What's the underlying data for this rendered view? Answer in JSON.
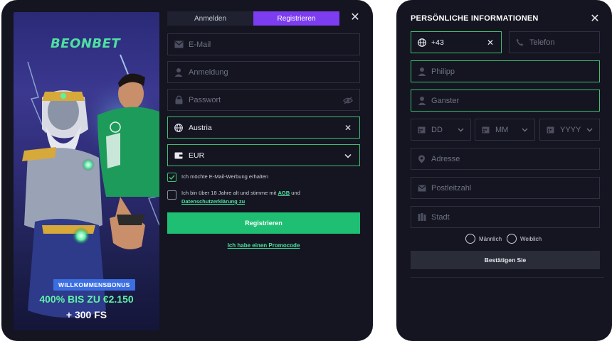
{
  "banner": {
    "logo": "BEONBET",
    "badge": "WILLKOMMENSBONUS",
    "main": "400% BIS ZU €2.150",
    "sub": "+ 300 FS"
  },
  "tabs": [
    {
      "label": "Anmelden",
      "active": false
    },
    {
      "label": "Registrieren",
      "active": true
    }
  ],
  "form": {
    "email_placeholder": "E-Mail",
    "login_placeholder": "Anmeldung",
    "password_placeholder": "Passwort",
    "country_value": "Austria",
    "currency_value": "EUR",
    "consent_email": "Ich möchte E-Mail-Werbung erhalten",
    "consent_age_prefix": "Ich bin über 18 Jahre alt und stimme mit",
    "consent_agb": "AGB",
    "consent_and": "und",
    "consent_privacy": "Datenschutzerklärung zu",
    "register_button": "Registrieren",
    "promo_link": "Ich habe einen Promocode"
  },
  "personal": {
    "title": "PERSÖNLICHE INFORMATIONEN",
    "phone_code": "+43",
    "phone_placeholder": "Telefon",
    "first_name": "Philipp",
    "last_name": "Ganster",
    "day_placeholder": "DD",
    "month_placeholder": "MM",
    "year_placeholder": "YYYY",
    "address_placeholder": "Adresse",
    "zip_placeholder": "Postleitzahl",
    "city_placeholder": "Stadt",
    "gender_male": "Männlich",
    "gender_female": "Weiblich",
    "confirm_button": "Bestätigen Sie"
  },
  "colors": {
    "accent_purple": "#7c3df0",
    "accent_green": "#1fbf73",
    "link_green": "#4ee0a0",
    "background": "#141520"
  }
}
